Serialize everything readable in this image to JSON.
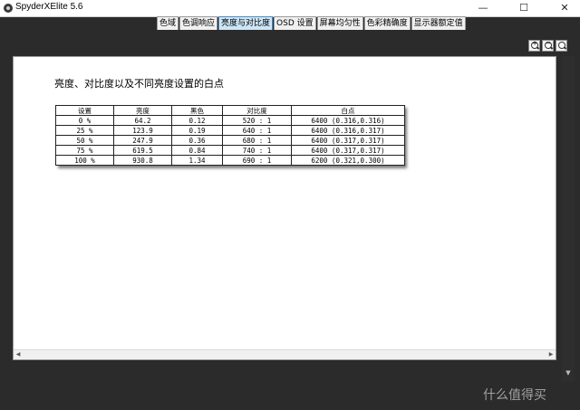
{
  "window": {
    "title": "SpyderXElite 5.6",
    "minimize_glyph": "—",
    "maximize_glyph": "☐",
    "close_glyph": "✕"
  },
  "tabs": [
    {
      "label": "色域",
      "active": false
    },
    {
      "label": "色调响应",
      "active": false
    },
    {
      "label": "亮度与对比度",
      "active": true
    },
    {
      "label": "OSD 设置",
      "active": false
    },
    {
      "label": "屏幕均匀性",
      "active": false
    },
    {
      "label": "色彩精确度",
      "active": false
    },
    {
      "label": "显示器额定值",
      "active": false
    }
  ],
  "zoom": {
    "zoom_in_symbol": "+",
    "zoom_out_symbol": "−",
    "zoom_fit_symbol": ""
  },
  "content": {
    "heading": "亮度、对比度以及不同亮度设置的白点",
    "table": {
      "columns": [
        "设置",
        "亮度",
        "黑色",
        "对比度",
        "白点"
      ],
      "rows": [
        [
          "0 %",
          "64.2",
          "0.12",
          "520 : 1",
          "6400 (0.316,0.316)"
        ],
        [
          "25 %",
          "123.9",
          "0.19",
          "640 : 1",
          "6400 (0.316,0.317)"
        ],
        [
          "50 %",
          "247.9",
          "0.36",
          "680 : 1",
          "6400 (0.317,0.317)"
        ],
        [
          "75 %",
          "619.5",
          "0.84",
          "740 : 1",
          "6400 (0.317,0.317)"
        ],
        [
          "100 %",
          "930.8",
          "1.34",
          "690 : 1",
          "6200 (0.321,0.300)"
        ]
      ]
    }
  },
  "scrollbar": {
    "left_arrow": "◀",
    "right_arrow": "▶",
    "down_arrow": "▼"
  },
  "watermark": "什么值得买"
}
